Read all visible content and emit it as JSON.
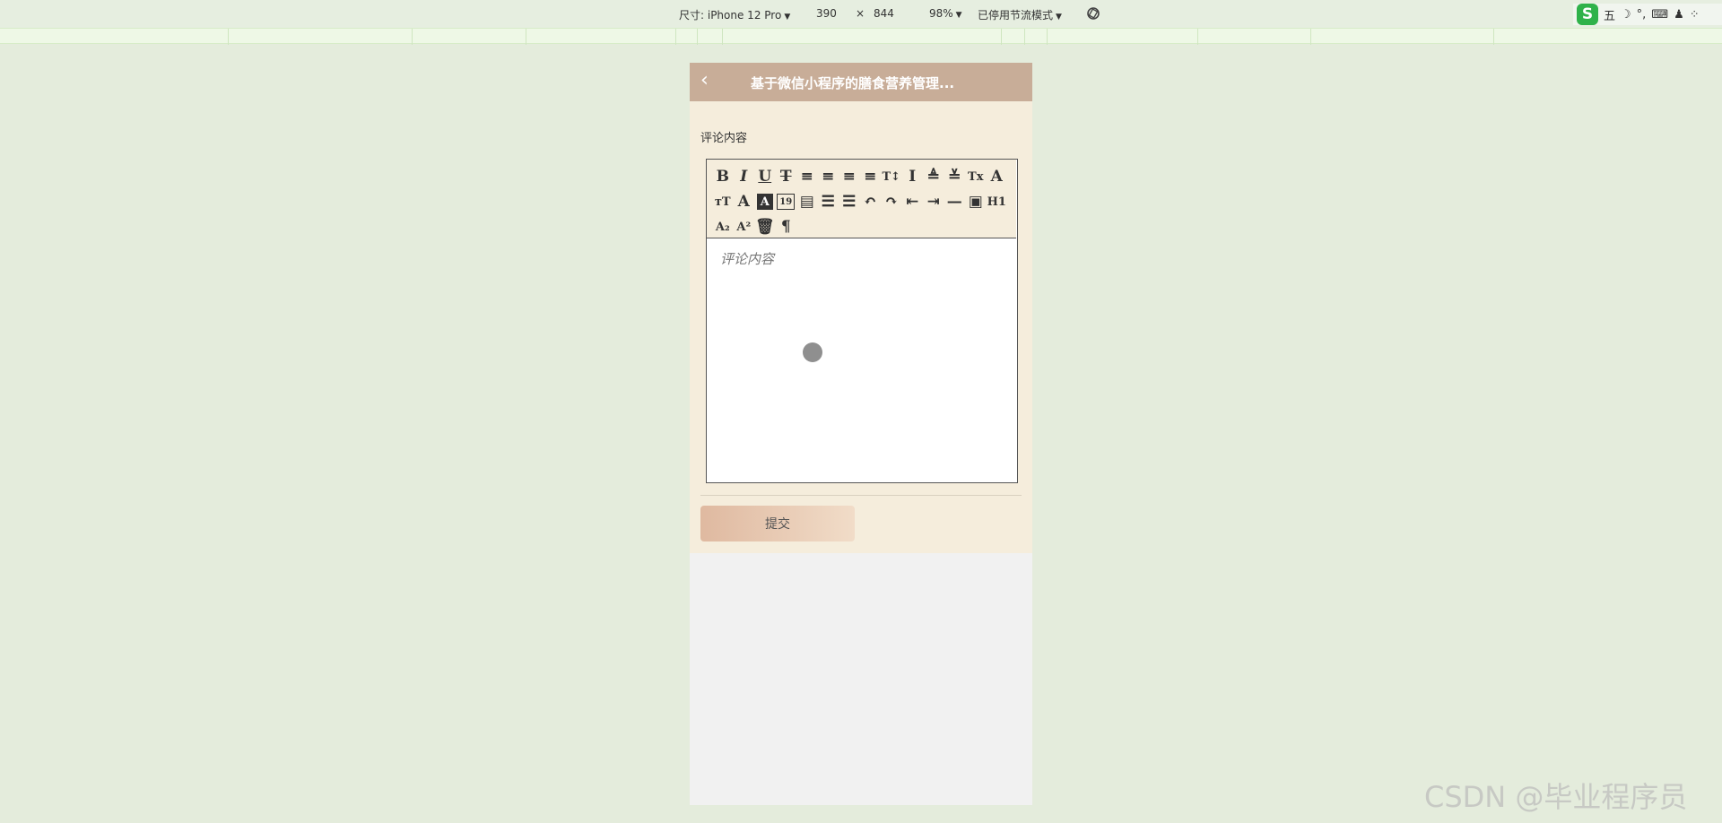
{
  "devtools": {
    "device_label": "尺寸: iPhone 12 Pro",
    "width": "390",
    "times": "×",
    "height": "844",
    "zoom": "98%",
    "throttle": "已停用节流模式"
  },
  "ime": {
    "logo": "S",
    "mode": "五",
    "items": [
      "☽",
      "°,",
      "⌨",
      "♟",
      "⁘"
    ]
  },
  "navbar": {
    "back_icon": "chevron-left",
    "title": "基于微信小程序的膳食营养管理..."
  },
  "form": {
    "field_label": "评论内容",
    "placeholder": "评论内容",
    "submit_label": "提交"
  },
  "toolbar": {
    "tools": [
      {
        "name": "bold",
        "glyph": "B"
      },
      {
        "name": "italic",
        "glyph": "I"
      },
      {
        "name": "underline",
        "glyph": "U"
      },
      {
        "name": "strikethrough",
        "glyph": "T"
      },
      {
        "name": "align-left",
        "glyph": "≡"
      },
      {
        "name": "align-center",
        "glyph": "≡"
      },
      {
        "name": "align-right",
        "glyph": "≡"
      },
      {
        "name": "align-justify",
        "glyph": "≡"
      },
      {
        "name": "font-size",
        "glyph": "T↕"
      },
      {
        "name": "line-height",
        "glyph": "I"
      },
      {
        "name": "spacing-before",
        "glyph": "≜"
      },
      {
        "name": "spacing-after",
        "glyph": "≚"
      },
      {
        "name": "remove-format",
        "glyph": "Tx"
      },
      {
        "name": "font-family",
        "glyph": "A"
      },
      {
        "name": "text-size",
        "glyph": "ᴛT"
      },
      {
        "name": "font-color",
        "glyph": "A"
      },
      {
        "name": "background-color",
        "glyph": "A"
      },
      {
        "name": "date",
        "glyph": "19"
      },
      {
        "name": "checklist",
        "glyph": "▤"
      },
      {
        "name": "ordered-list",
        "glyph": "☰"
      },
      {
        "name": "bullet-list",
        "glyph": "☰"
      },
      {
        "name": "undo",
        "glyph": "↶"
      },
      {
        "name": "redo",
        "glyph": "↷"
      },
      {
        "name": "outdent",
        "glyph": "⇤"
      },
      {
        "name": "indent",
        "glyph": "⇥"
      },
      {
        "name": "horizontal-rule",
        "glyph": "—"
      },
      {
        "name": "image",
        "glyph": "▣"
      },
      {
        "name": "heading",
        "glyph": "H1"
      },
      {
        "name": "subscript",
        "glyph": "A₂"
      },
      {
        "name": "superscript",
        "glyph": "A²"
      },
      {
        "name": "clear",
        "glyph": "🗑"
      },
      {
        "name": "direction",
        "glyph": "¶"
      }
    ]
  },
  "watermark": "CSDN @毕业程序员"
}
